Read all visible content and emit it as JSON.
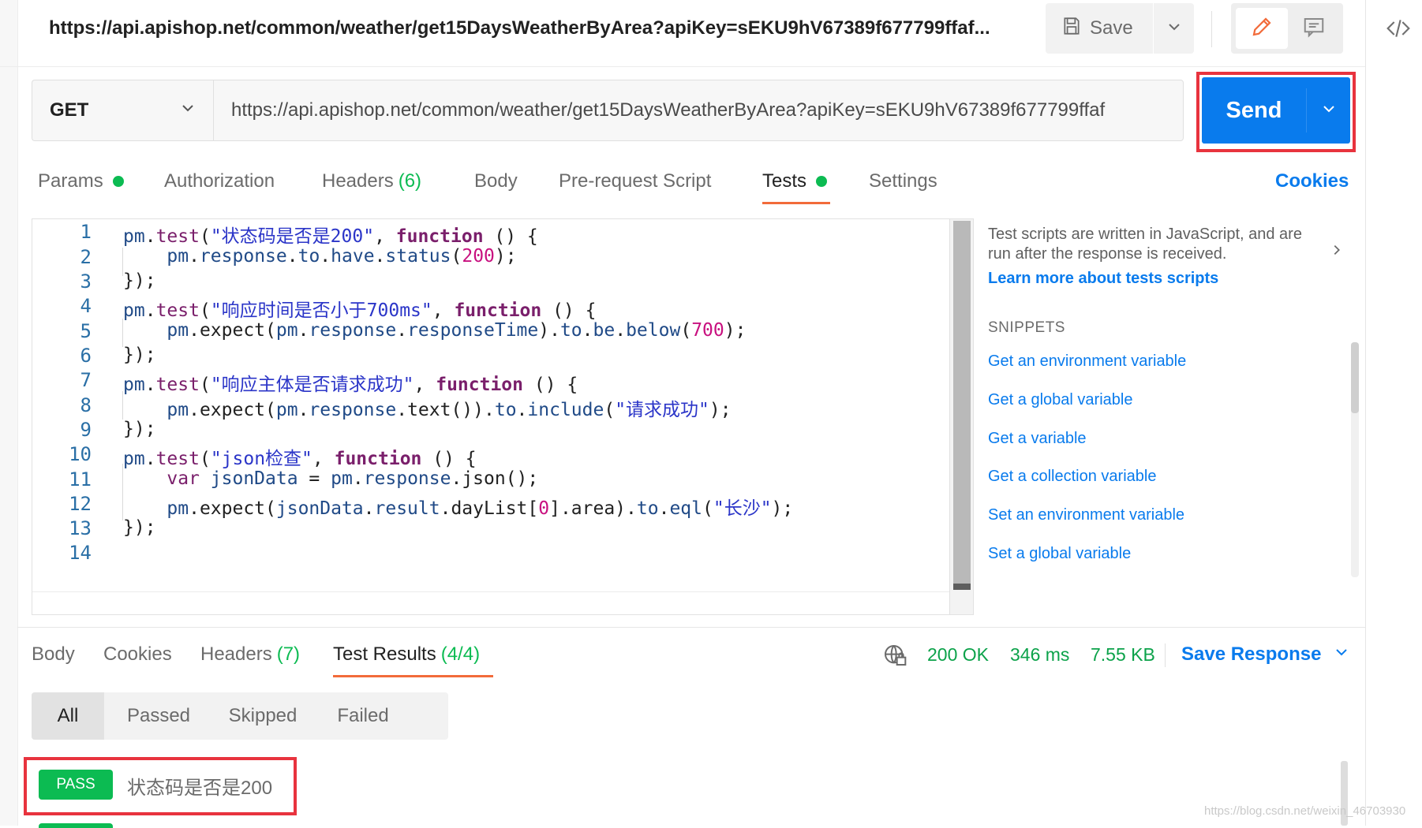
{
  "header": {
    "request_title": "https://api.apishop.net/common/weather/get15DaysWeatherByArea?apiKey=sEKU9hV67389f677799ffaf...",
    "save_label": "Save",
    "save_icon": "floppy-disk-icon",
    "edit_icon": "pencil-icon",
    "doc_icon": "comment-icon",
    "code_icon": "code-brackets-icon"
  },
  "request": {
    "method": "GET",
    "url": "https://api.apishop.net/common/weather/get15DaysWeatherByArea?apiKey=sEKU9hV67389f677799ffaf",
    "send_label": "Send"
  },
  "tabs": {
    "params": "Params",
    "authorization": "Authorization",
    "headers": "Headers",
    "headers_count": "(6)",
    "body": "Body",
    "prerequest": "Pre-request Script",
    "tests": "Tests",
    "settings": "Settings",
    "cookies": "Cookies",
    "active": "Tests"
  },
  "editor": {
    "line_numbers": [
      "1",
      "2",
      "3",
      "4",
      "5",
      "6",
      "7",
      "8",
      "9",
      "10",
      "11",
      "12",
      "13",
      "14"
    ],
    "strings": {
      "t1": "\"状态码是否是200\"",
      "n200": "200",
      "t2": "\"响应时间是否小于700ms\"",
      "n700": "700",
      "t3": "\"响应主体是否请求成功\"",
      "s_ok": "\"请求成功\"",
      "t4": "\"json检查\"",
      "n0": "0",
      "s_cs": "\"长沙\""
    }
  },
  "side_panel": {
    "description": "Test scripts are written in JavaScript, and are run after the response is received.",
    "learn_more": "Learn more about tests scripts",
    "snippets_title": "SNIPPETS",
    "snippets": [
      "Get an environment variable",
      "Get a global variable",
      "Get a variable",
      "Get a collection variable",
      "Set an environment variable",
      "Set a global variable"
    ]
  },
  "response": {
    "tabs": {
      "body": "Body",
      "cookies": "Cookies",
      "headers": "Headers",
      "headers_count": "(7)",
      "test_results": "Test Results",
      "test_results_count": "(4/4)"
    },
    "status": "200 OK",
    "time": "346 ms",
    "size": "7.55 KB",
    "save_response": "Save Response",
    "filters": [
      "All",
      "Passed",
      "Skipped",
      "Failed"
    ],
    "results": [
      {
        "badge": "PASS",
        "name": "状态码是否是200"
      }
    ]
  },
  "colors": {
    "accent_blue": "#097bed",
    "pass_green": "#0cbb52",
    "active_tab_orange": "#f26b3a",
    "highlight_red": "#e8333e"
  },
  "watermark": "https://blog.csdn.net/weixin_46703930"
}
